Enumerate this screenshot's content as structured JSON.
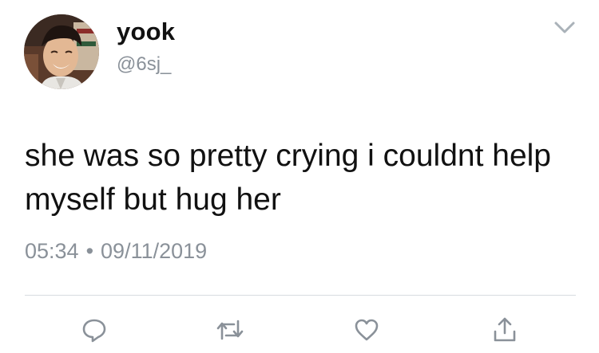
{
  "user": {
    "display_name": "yook",
    "handle": "@6sj_",
    "avatar_icon": "profile-photo"
  },
  "tweet": {
    "text": "she was so pretty crying i couldnt help myself but hug her",
    "time": "05:34",
    "separator": "•",
    "date": "09/11/2019"
  },
  "actions": [
    {
      "name": "reply",
      "icon": "speech-bubble-icon"
    },
    {
      "name": "retweet",
      "icon": "retweet-icon"
    },
    {
      "name": "like",
      "icon": "heart-icon"
    },
    {
      "name": "share",
      "icon": "share-icon"
    }
  ],
  "colors": {
    "text": "#111111",
    "secondary": "#8a9199",
    "divider": "#d6dbe0",
    "icon": "#8a9199"
  }
}
